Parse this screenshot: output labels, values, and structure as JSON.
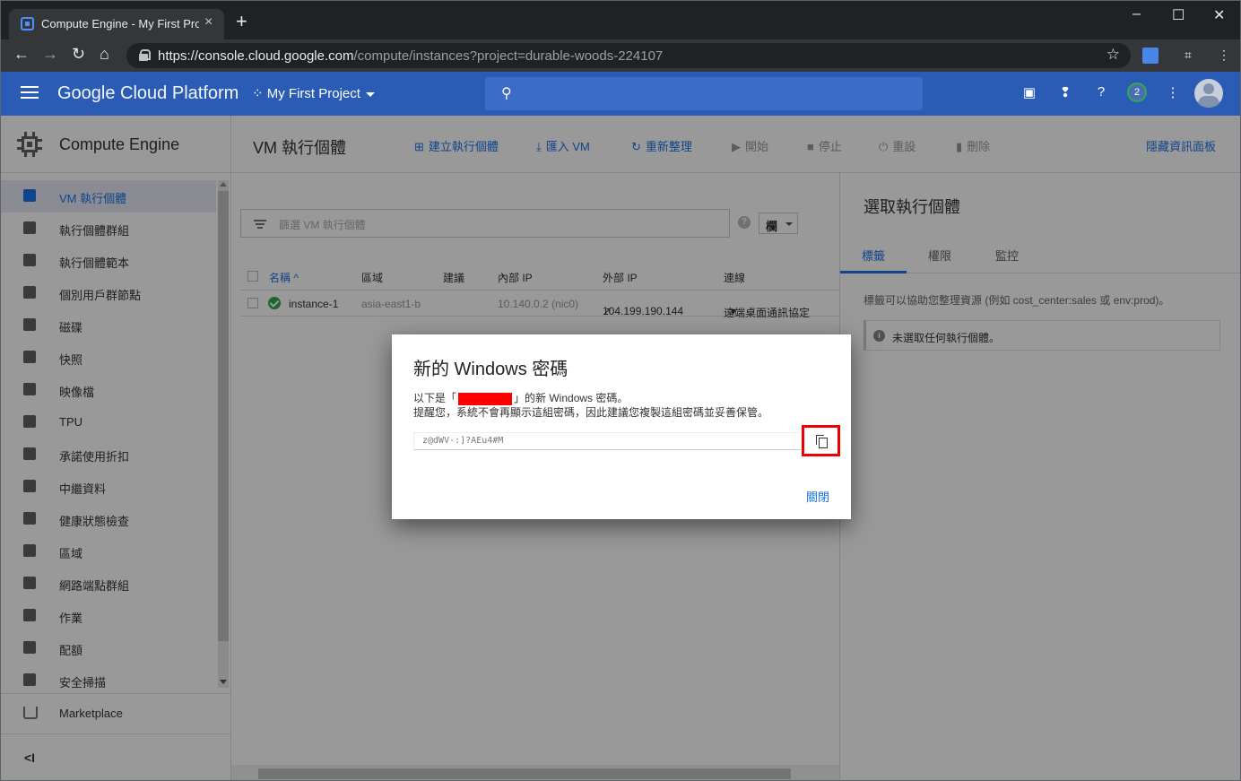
{
  "browser": {
    "tab_title": "Compute Engine - My First Proj",
    "url_host": "https://console.cloud.google.com",
    "url_path": "/compute/instances?project=durable-woods-224107",
    "new_tab": "+",
    "tab_close": "×",
    "window_controls": [
      "–",
      "☐",
      "✕"
    ],
    "nav": {
      "back": "←",
      "forward": "→",
      "reload": "↻",
      "home": "⌂"
    }
  },
  "gcp": {
    "brand": "Google Cloud Platform",
    "project": "My First Project",
    "notification_count": "2"
  },
  "sidebar": {
    "title": "Compute Engine",
    "items": [
      {
        "label": "VM 執行個體",
        "icon": "vm-instance-icon"
      },
      {
        "label": "執行個體群組",
        "icon": "instance-group-icon"
      },
      {
        "label": "執行個體範本",
        "icon": "template-icon"
      },
      {
        "label": "個別用戶群節點",
        "icon": "sole-tenant-icon"
      },
      {
        "label": "磁碟",
        "icon": "disk-icon"
      },
      {
        "label": "快照",
        "icon": "snapshot-icon"
      },
      {
        "label": "映像檔",
        "icon": "image-icon"
      },
      {
        "label": "TPU",
        "icon": "tpu-icon"
      },
      {
        "label": "承諾使用折扣",
        "icon": "discount-icon"
      },
      {
        "label": "中繼資料",
        "icon": "metadata-icon"
      },
      {
        "label": "健康狀態檢查",
        "icon": "health-check-icon"
      },
      {
        "label": "區域",
        "icon": "zone-icon"
      },
      {
        "label": "網路端點群組",
        "icon": "network-endpoint-icon"
      },
      {
        "label": "作業",
        "icon": "operations-icon"
      },
      {
        "label": "配額",
        "icon": "quota-icon"
      },
      {
        "label": "安全掃描",
        "icon": "security-scan-icon"
      }
    ],
    "marketplace": "Marketplace",
    "collapse": "<I"
  },
  "toolbar": {
    "page_title": "VM 執行個體",
    "create": "建立執行個體",
    "import": "匯入 VM",
    "refresh": "重新整理",
    "start": "開始",
    "stop": "停止",
    "reset": "重設",
    "delete": "刪除",
    "hide_panel": "隱藏資訊面板"
  },
  "list": {
    "filter_placeholder": "篩選 VM 執行個體",
    "columns_btn": "欄",
    "headers": {
      "name": "名稱 ^",
      "zone": "區域",
      "recommendation": "建議",
      "internal_ip": "內部 IP",
      "external_ip": "外部 IP",
      "connect": "連線"
    },
    "rows": [
      {
        "name": "instance-1",
        "zone": "asia-east1-b",
        "recommendation": "",
        "internal_ip": "10.140.0.2 (nic0)",
        "external_ip": "104.199.190.144",
        "connect": "遠端桌面通訊協定"
      }
    ]
  },
  "info_panel": {
    "title": "選取執行個體",
    "tabs": [
      "標籤",
      "權限",
      "監控"
    ],
    "description": "標籤可以協助您整理資源 (例如 cost_center:sales 或 env:prod)。",
    "empty_message": "未選取任何執行個體。"
  },
  "dialog": {
    "title": "新的 Windows 密碼",
    "line1_prefix": "以下是「",
    "line1_suffix": "」的新 Windows 密碼。",
    "line2": "提醒您，系統不會再顯示這組密碼，因此建議您複製這組密碼並妥善保管。",
    "password": "z@dWV-:]?AEu4#M",
    "close": "關閉"
  },
  "colors": {
    "gcp_blue": "#2a5cb6",
    "link_blue": "#1a73e8",
    "ok_green": "#34a853",
    "highlight_red": "#e00000"
  }
}
